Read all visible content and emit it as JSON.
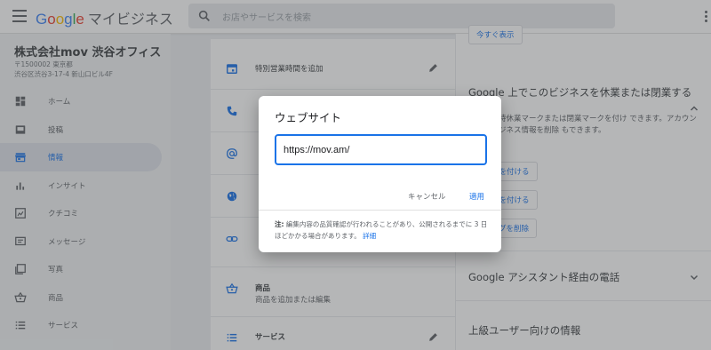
{
  "header": {
    "logo_letters": [
      "G",
      "o",
      "o",
      "g",
      "l",
      "e"
    ],
    "logo_suffix": "マイビジネス",
    "search_placeholder": "お店やサービスを検索"
  },
  "sidebar": {
    "business_name": "株式会社mov 渋谷オフィス",
    "address_line1": "〒1500002 東京都",
    "address_line2": "渋谷区渋谷3-17-4 新山口ビル4F",
    "items": [
      {
        "label": "ホーム",
        "icon": "dashboard-icon"
      },
      {
        "label": "投稿",
        "icon": "posts-icon"
      },
      {
        "label": "情報",
        "icon": "storefront-icon",
        "active": true
      },
      {
        "label": "インサイト",
        "icon": "bar-chart-icon"
      },
      {
        "label": "クチコミ",
        "icon": "reviews-icon"
      },
      {
        "label": "メッセージ",
        "icon": "message-icon"
      },
      {
        "label": "写真",
        "icon": "photos-icon"
      },
      {
        "label": "商品",
        "icon": "shopping-basket-icon"
      },
      {
        "label": "サービス",
        "icon": "list-icon"
      }
    ]
  },
  "main": {
    "special_hours": "特別営業時間を追加",
    "products_title": "商品",
    "products_sub": "商品を追加または編集",
    "services_title": "サービス"
  },
  "right": {
    "top_button": "今すぐ表示",
    "closure_heading": "Google 上でこのビジネスを休業または閉業する",
    "closure_text": "ネスに臨時休業マークまたは閉業マークを付け できます。アカウントからビジネス情報を削除 もできます。",
    "btn_temp_closed": "マークを付ける",
    "btn_perm_closed": "マークを付ける",
    "btn_remove": "ティングを削除",
    "assistant_heading": "Google アシスタント経由の電話",
    "advanced_heading": "上級ユーザー向けの情報"
  },
  "dialog": {
    "title": "ウェブサイト",
    "input_value": "https://mov.am/",
    "cancel_label": "キャンセル",
    "apply_label": "適用",
    "note_label": "注:",
    "note_text": "編集内容の品質確認が行われることがあり、公開されるまでに 3 日ほどかかる場合があります。",
    "note_link": "詳細"
  },
  "colors": {
    "accent": "#1a73e8",
    "overlay": "#3c4043"
  }
}
